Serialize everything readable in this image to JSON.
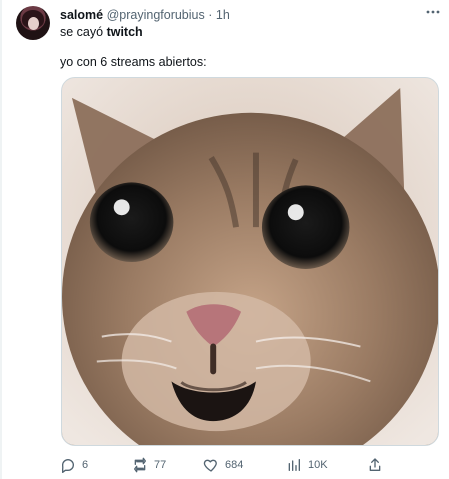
{
  "tweet": {
    "author": {
      "display_name": "salomé",
      "handle": "@prayingforubius",
      "separator": "·",
      "time": "1h"
    },
    "more_icon": "ellipsis-icon",
    "text": {
      "line1_prefix": "se cayó ",
      "line1_bold": "twitch",
      "line2": "yo con 6 streams abiertos:"
    },
    "media": {
      "type": "image",
      "description_icon": "cat-meme-image"
    },
    "actions": [
      {
        "name": "reply",
        "icon": "comment-icon",
        "count": "6"
      },
      {
        "name": "retweet",
        "icon": "retweet-icon",
        "count": "77"
      },
      {
        "name": "like",
        "icon": "heart-icon",
        "count": "684"
      },
      {
        "name": "views",
        "icon": "chart-icon",
        "count": "10K"
      },
      {
        "name": "share",
        "icon": "share-icon",
        "count": ""
      }
    ],
    "colors": {
      "text": "#0f1419",
      "secondary": "#536471",
      "border": "#cfd9de",
      "background": "#ffffff"
    }
  }
}
